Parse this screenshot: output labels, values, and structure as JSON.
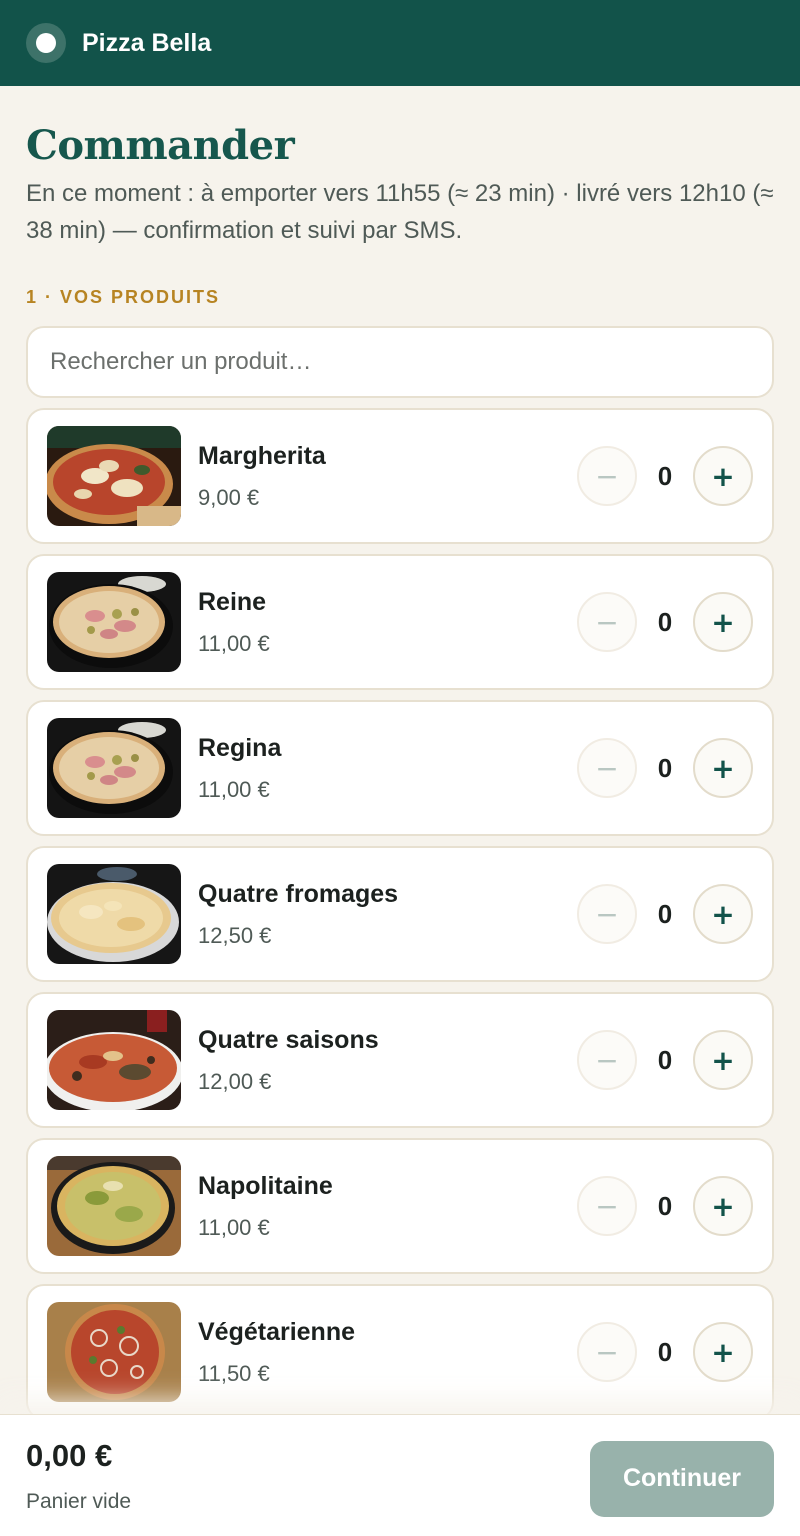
{
  "app": {
    "brand": "Pizza Bella",
    "brand_color": "#12534a",
    "accent_color": "#b78422",
    "logo_icon": "logo-circle-icon"
  },
  "header": {
    "title": "Commander",
    "subtitle": "En ce moment : à emporter vers 11h55 (≈ 23 min) · livré vers 12h10 (≈ 38 min) — confirmation et suivi par SMS."
  },
  "section": {
    "label": "1 · VOS PRODUITS"
  },
  "search": {
    "placeholder": "Rechercher un produit…",
    "value": ""
  },
  "products": [
    {
      "name": "Margherita",
      "price": "9,00 €",
      "quantity": "0",
      "minus": "−",
      "plus": "+"
    },
    {
      "name": "Reine",
      "price": "11,00 €",
      "quantity": "0",
      "minus": "−",
      "plus": "+"
    },
    {
      "name": "Regina",
      "price": "11,00 €",
      "quantity": "0",
      "minus": "−",
      "plus": "+"
    },
    {
      "name": "Quatre fromages",
      "price": "12,50 €",
      "quantity": "0",
      "minus": "−",
      "plus": "+"
    },
    {
      "name": "Quatre saisons",
      "price": "12,00 €",
      "quantity": "0",
      "minus": "−",
      "plus": "+"
    },
    {
      "name": "Napolitaine",
      "price": "11,00 €",
      "quantity": "0",
      "minus": "−",
      "plus": "+"
    },
    {
      "name": "Végétarienne",
      "price": "11,50 €",
      "quantity": "0",
      "minus": "−",
      "plus": "+"
    }
  ],
  "footer": {
    "total": "0,00 €",
    "cart_status": "Panier vide",
    "continue_label": "Continuer"
  }
}
